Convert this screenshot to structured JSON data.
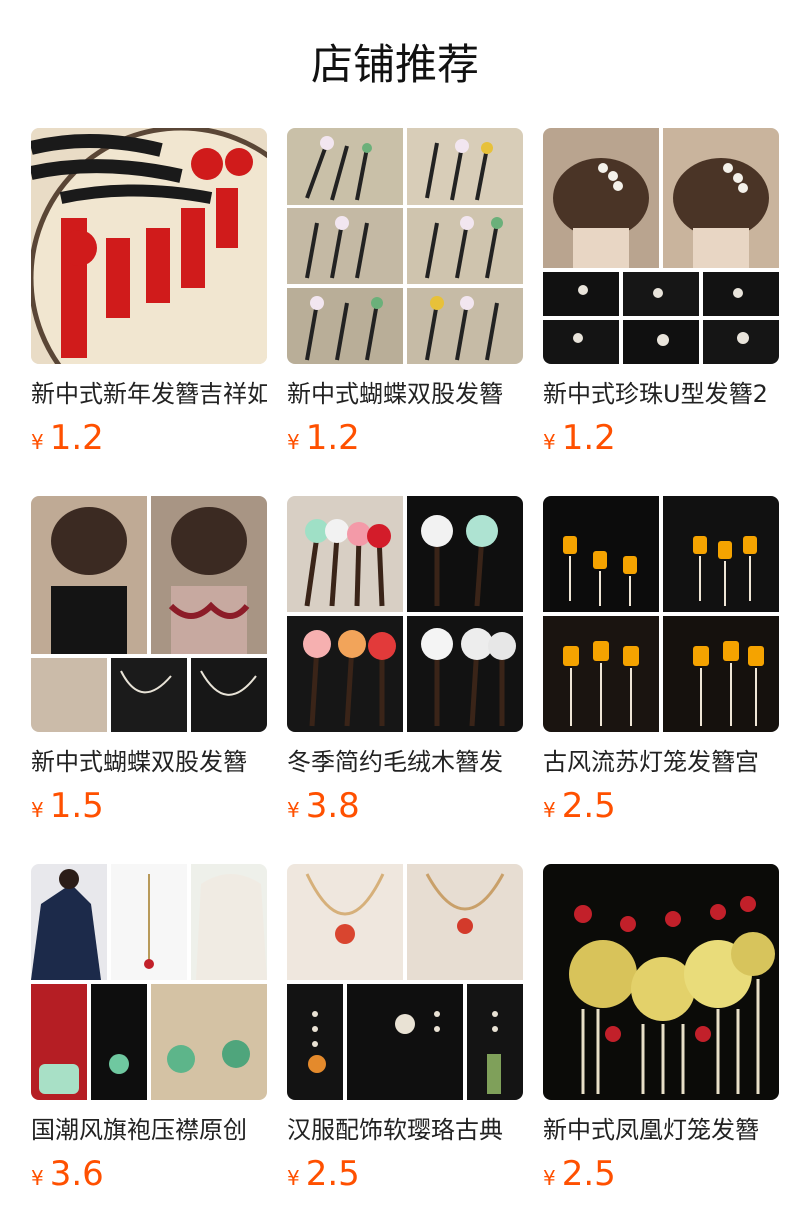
{
  "header": {
    "title": "店铺推荐"
  },
  "colors": {
    "price": "#ff5000",
    "title": "#222222"
  },
  "products": [
    {
      "title": "新中式新年发簪吉祥如意",
      "currency": "¥",
      "price": "1.2",
      "image": "red-tassel-hairpins"
    },
    {
      "title": "新中式蝴蝶双股发簪",
      "currency": "¥",
      "price": "1.2",
      "image": "flower-hairsticks"
    },
    {
      "title": "新中式珍珠U型发簪2",
      "currency": "¥",
      "price": "1.2",
      "image": "pearl-u-hairpin"
    },
    {
      "title": "新中式蝴蝶双股发簪",
      "currency": "¥",
      "price": "1.5",
      "image": "chain-hairpins"
    },
    {
      "title": "冬季简约毛绒木簪发",
      "currency": "¥",
      "price": "3.8",
      "image": "fluffy-wood-hairsticks"
    },
    {
      "title": "古风流苏灯笼发簪宫",
      "currency": "¥",
      "price": "2.5",
      "image": "lantern-tassel-hairpins"
    },
    {
      "title": "国潮风旗袍压襟原创",
      "currency": "¥",
      "price": "3.6",
      "image": "qipao-pendants"
    },
    {
      "title": "汉服配饰软璎珞古典",
      "currency": "¥",
      "price": "2.5",
      "image": "beaded-necklaces"
    },
    {
      "title": "新中式凤凰灯笼发簪",
      "currency": "¥",
      "price": "2.5",
      "image": "phoenix-lantern-hairpin"
    }
  ]
}
